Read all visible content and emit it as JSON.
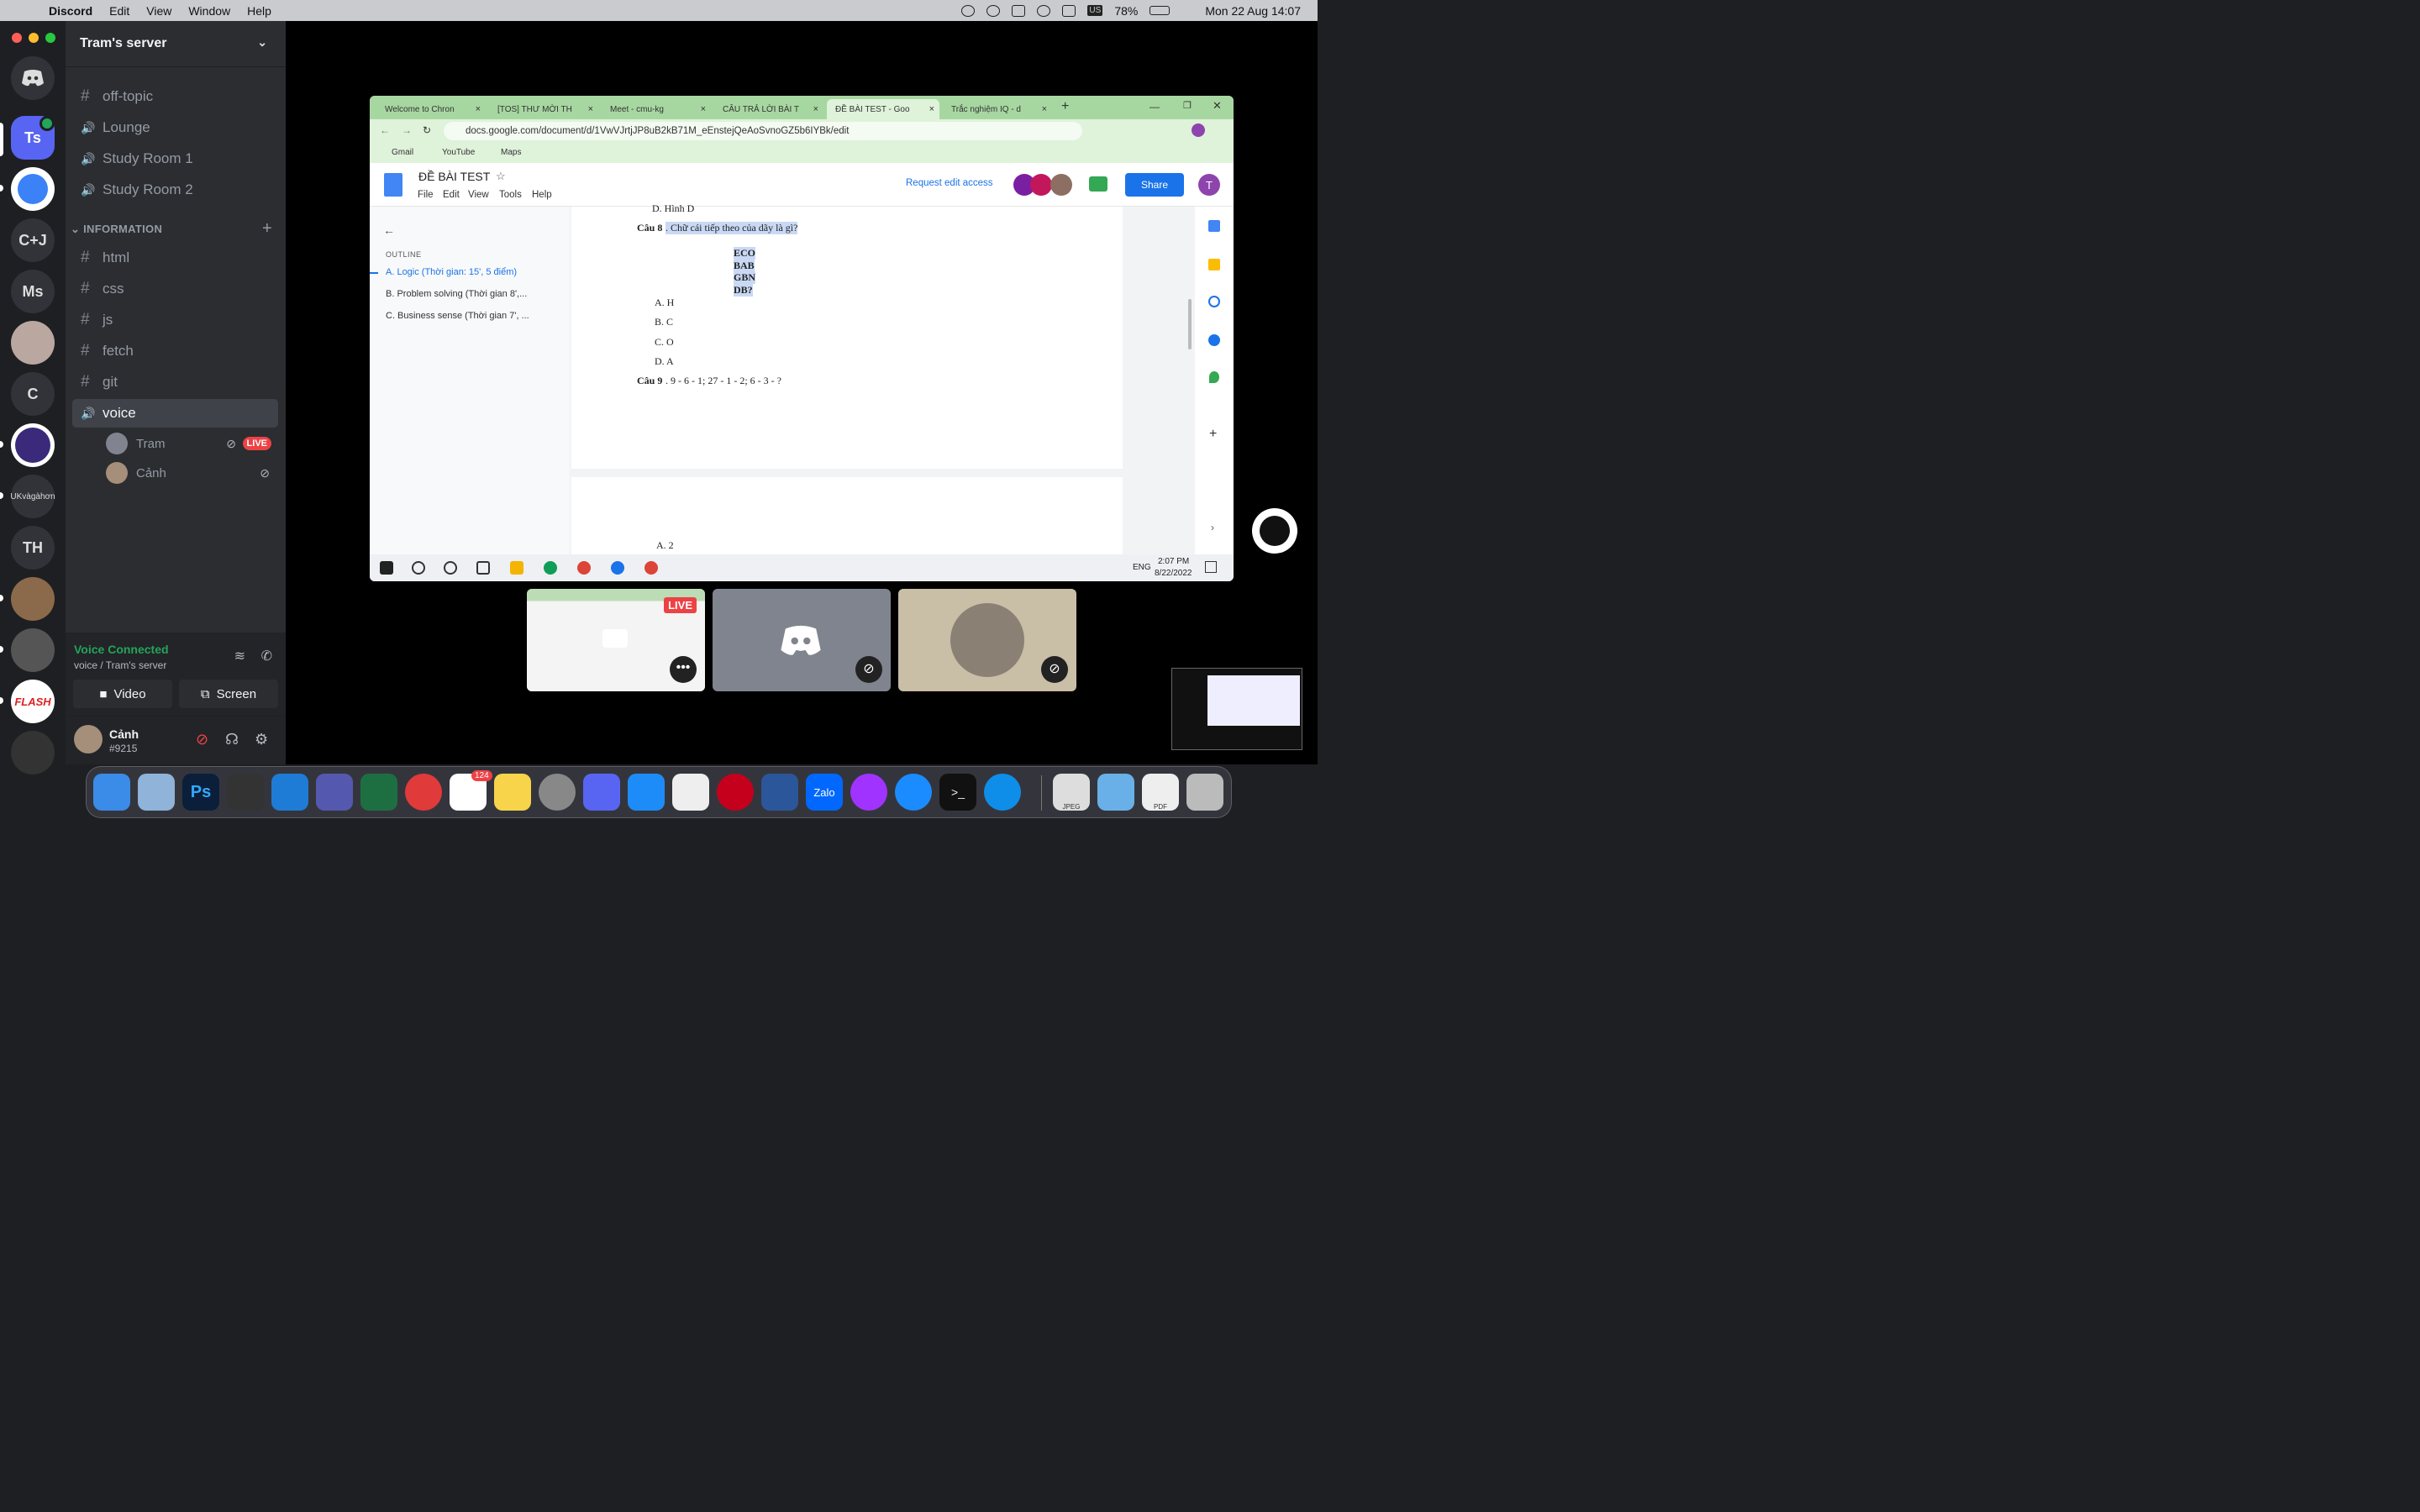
{
  "menubar": {
    "app": "Discord",
    "items": [
      "Edit",
      "View",
      "Window",
      "Help"
    ],
    "battery": "78%",
    "datetime": "Mon 22 Aug  14:07",
    "input": "US"
  },
  "guilds": [
    "Ts",
    "C+J",
    "Ms",
    "C",
    "UKvàgàhơn",
    "TH"
  ],
  "server": {
    "name": "Tram's server"
  },
  "channels": {
    "top": [
      {
        "icon": "#",
        "name": "off-topic"
      },
      {
        "icon": "🔊",
        "name": "Lounge"
      },
      {
        "icon": "🔊",
        "name": "Study Room 1"
      },
      {
        "icon": "🔊",
        "name": "Study Room 2"
      }
    ],
    "category": "INFORMATION",
    "info": [
      {
        "icon": "#",
        "name": "html"
      },
      {
        "icon": "#",
        "name": "css"
      },
      {
        "icon": "#",
        "name": "js"
      },
      {
        "icon": "#",
        "name": "fetch"
      },
      {
        "icon": "#",
        "name": "git"
      },
      {
        "icon": "🔊",
        "name": "voice"
      }
    ],
    "voice_users": [
      {
        "name": "Tram",
        "badge": "LIVE"
      },
      {
        "name": "Cảnh"
      }
    ]
  },
  "voice_panel": {
    "title": "Voice Connected",
    "subtitle": "voice / Tram's server",
    "video": "Video",
    "screen": "Screen"
  },
  "user": {
    "name": "Cảnh",
    "tag": "#9215"
  },
  "stream": {
    "tabs": [
      "Welcome to Chron",
      "[TOS] THƯ MỜI TH",
      "Meet - cmu-kg",
      "CÂU TRẢ LỜI BÀI T",
      "ĐỀ BÀI TEST - Goo",
      "Trắc nghiệm IQ - d"
    ],
    "url": "docs.google.com/document/d/1VwVJrtjJP8uB2kB71M_eEnstejQeAoSvnoGZ5b6IYBk/edit",
    "bookmarks": [
      "Gmail",
      "YouTube",
      "Maps"
    ],
    "doc_title": "ĐỀ BÀI TEST",
    "doc_menu": [
      "File",
      "Edit",
      "View",
      "Tools",
      "Help"
    ],
    "request": "Request edit access",
    "share": "Share",
    "avatar_initial": "T",
    "outline_heading": "OUTLINE",
    "outline": [
      "A. Logic (Thời gian: 15', 5 điểm)",
      "B. Problem solving (Thời gian 8',...",
      "C. Business sense (Thời gian 7', ..."
    ],
    "page": {
      "prev": "D.  Hình D",
      "q8_label": "Câu 8",
      "q8_text": ". Chữ cái tiếp theo của dãy là gì?",
      "seq": [
        "ECO",
        "BAB",
        "GBN",
        "DB?"
      ],
      "answers": [
        "A. H",
        "B. C",
        "C. O",
        "D. A"
      ],
      "q9_label": "Câu 9",
      "q9_text": ". 9 - 6 - 1; 27 - 1 - 2; 6 - 3 - ?",
      "next": "A.  2"
    },
    "taskbar": {
      "lang": "ENG",
      "time": "2:07 PM",
      "date": "8/22/2022"
    }
  },
  "tiles": {
    "live": "LIVE"
  },
  "dock": {
    "reminders_badge": "124",
    "jpeg": "JPEG",
    "pdf": "PDF"
  }
}
